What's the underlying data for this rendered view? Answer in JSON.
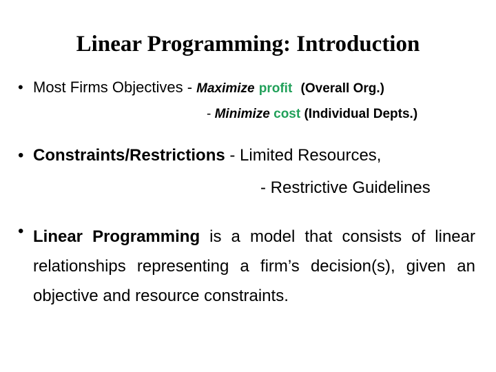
{
  "slide": {
    "title": "Linear Programming: Introduction",
    "bullet_glyph": "•",
    "bullets": [
      {
        "lead": "Most Firms Objectives - ",
        "objective_1": {
          "verb": "Maximize",
          "target": "profit",
          "scope": "(Overall Org.)"
        },
        "objective_2": {
          "dash": "- ",
          "verb": "Minimize",
          "target": "cost",
          "scope": "(Individual Depts.)"
        }
      },
      {
        "term": "Constraints/Restrictions",
        "line_1": " - Limited Resources,",
        "line_2": "- Restrictive Guidelines"
      },
      {
        "term": "Linear Programming",
        "definition": " is a model that consists of linear relationships representing a firm’s decision(s), given an objective and resource constraints."
      }
    ],
    "colors": {
      "text": "#000000",
      "accent_green": "#22a05a",
      "background": "#ffffff"
    }
  }
}
